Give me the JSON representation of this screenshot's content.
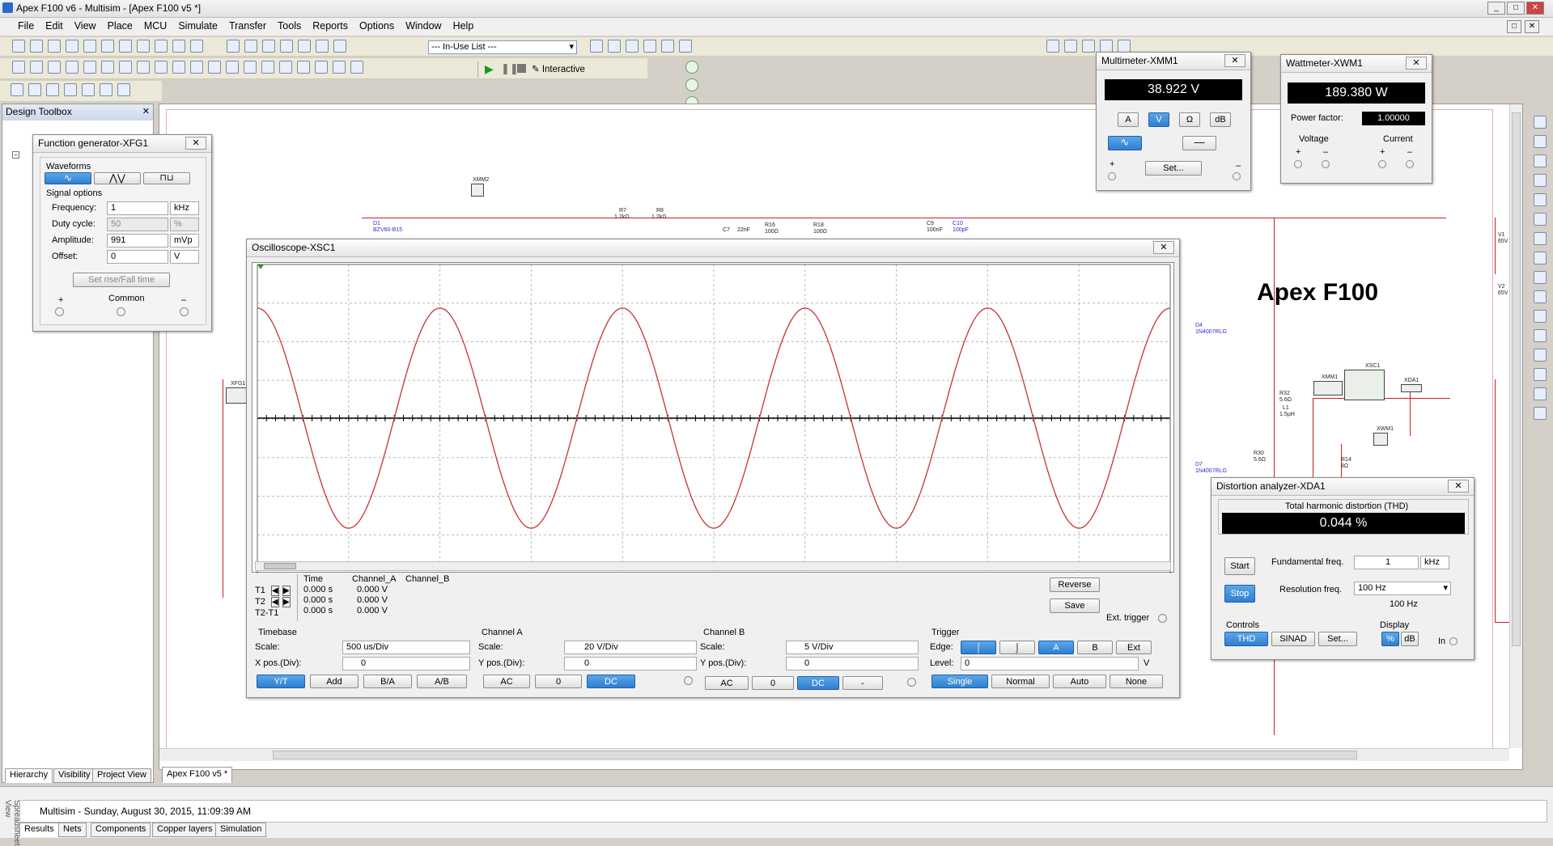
{
  "app": {
    "title": "Apex F100 v6 - Multisim - [Apex F100 v5 *]"
  },
  "menu": [
    "File",
    "Edit",
    "View",
    "Place",
    "MCU",
    "Simulate",
    "Transfer",
    "Tools",
    "Reports",
    "Options",
    "Window",
    "Help"
  ],
  "toolbar": {
    "in_use_list": "--- In-Use List ---",
    "interactive_label": "Interactive"
  },
  "design_toolbox": {
    "title": "Design Toolbox",
    "tabs": [
      "Hierarchy",
      "Visibility",
      "Project View"
    ]
  },
  "schematic": {
    "heading": "Apex F100",
    "doc_tab": "Apex F100 v5 *",
    "labels": {
      "xmm2": "XMM2",
      "d1": "D1",
      "d1v": "BZV60-B15",
      "r7": "R7",
      "r7v": "1.2kΩ",
      "r8": "R8",
      "r8v": "1.2kΩ",
      "c7": "C7",
      "c7v": "22nF",
      "r16": "R16",
      "r16v": "100Ω",
      "r18": "R18",
      "r18v": "100Ω",
      "c9": "C9",
      "c9v": "100nF",
      "c10": "C10",
      "c10v": "100pF",
      "v1": "V1",
      "v1v": "65V",
      "v2": "V2",
      "v2v": "65V",
      "d4": "D4",
      "d4v": "1N4007RLG",
      "d7": "D7",
      "d7v": "1N4007RLG",
      "r32": "R32",
      "r32v": "5.6Ω",
      "l1": "L1",
      "l1v": "1.5µH",
      "r30": "R30",
      "r30v": "5.6Ω",
      "r14": "R14",
      "r14v": "8Ω",
      "xmm1": "XMM1",
      "xsc1": "XSC1",
      "xda1": "XDA1",
      "xwm1": "XWM1",
      "xfg1": "XFG1"
    }
  },
  "function_generator": {
    "title": "Function generator-XFG1",
    "waveforms_label": "Waveforms",
    "signal_options_label": "Signal options",
    "rows": [
      {
        "label": "Frequency:",
        "value": "1",
        "unit": "kHz"
      },
      {
        "label": "Duty cycle:",
        "value": "50",
        "unit": "%"
      },
      {
        "label": "Amplitude:",
        "value": "991",
        "unit": "mVp"
      },
      {
        "label": "Offset:",
        "value": "0",
        "unit": "V"
      }
    ],
    "rise_fall": "Set rise/Fall time",
    "plus": "+",
    "common": "Common",
    "minus": "–"
  },
  "multimeter": {
    "title": "Multimeter-XMM1",
    "reading": "38.922 V",
    "modes": [
      "A",
      "V",
      "Ω",
      "dB"
    ],
    "set": "Set...",
    "plus": "+",
    "minus": "–"
  },
  "wattmeter": {
    "title": "Wattmeter-XWM1",
    "reading": "189.380 W",
    "pf_label": "Power factor:",
    "pf_value": "1.00000",
    "voltage": "Voltage",
    "current": "Current",
    "plus": "+",
    "minus": "–"
  },
  "oscilloscope": {
    "title": "Oscilloscope-XSC1",
    "readout": {
      "headers": [
        "Time",
        "Channel_A",
        "Channel_B"
      ],
      "rows": [
        {
          "label": "T1",
          "time": "0.000 s",
          "a": "0.000 V"
        },
        {
          "label": "T2",
          "time": "0.000 s",
          "a": "0.000 V"
        },
        {
          "label": "T2-T1",
          "time": "0.000 s",
          "a": "0.000 V"
        }
      ]
    },
    "reverse": "Reverse",
    "save": "Save",
    "ext_trigger": "Ext. trigger",
    "timebase": {
      "title": "Timebase",
      "scale_label": "Scale:",
      "scale": "500 us/Div",
      "xpos_label": "X pos.(Div):",
      "xpos": "0",
      "buttons": [
        "Y/T",
        "Add",
        "B/A",
        "A/B"
      ]
    },
    "channel_a": {
      "title": "Channel A",
      "scale_label": "Scale:",
      "scale": "20  V/Div",
      "ypos_label": "Y pos.(Div):",
      "ypos": "0",
      "buttons": [
        "AC",
        "0",
        "DC"
      ]
    },
    "channel_b": {
      "title": "Channel B",
      "scale_label": "Scale:",
      "scale": "5  V/Div",
      "ypos_label": "Y pos.(Div):",
      "ypos": "0",
      "buttons": [
        "AC",
        "0",
        "DC",
        "-"
      ]
    },
    "trigger": {
      "title": "Trigger",
      "edge_label": "Edge:",
      "edges": [
        "A",
        "B",
        "Ext"
      ],
      "level_label": "Level:",
      "level": "0",
      "level_unit": "V",
      "modes": [
        "Single",
        "Normal",
        "Auto",
        "None"
      ]
    }
  },
  "distortion": {
    "title": "Distortion analyzer-XDA1",
    "thd_label": "Total harmonic distortion (THD)",
    "reading": "0.044 %",
    "start": "Start",
    "stop": "Stop",
    "fund_label": "Fundamental freq.",
    "fund_value": "1",
    "fund_unit": "kHz",
    "res_label": "Resolution freq.",
    "res_value": "100 Hz",
    "res_sub": "100 Hz",
    "controls": "Controls",
    "display": "Display",
    "ctrl_buttons": [
      "THD",
      "SINAD",
      "Set..."
    ],
    "disp_buttons": [
      "%",
      "dB"
    ],
    "in": "In"
  },
  "status": {
    "message": "Multisim  -  Sunday, August 30, 2015, 11:09:39 AM",
    "tabs": [
      "Results",
      "Nets",
      "Components",
      "Copper layers",
      "Simulation"
    ]
  }
}
